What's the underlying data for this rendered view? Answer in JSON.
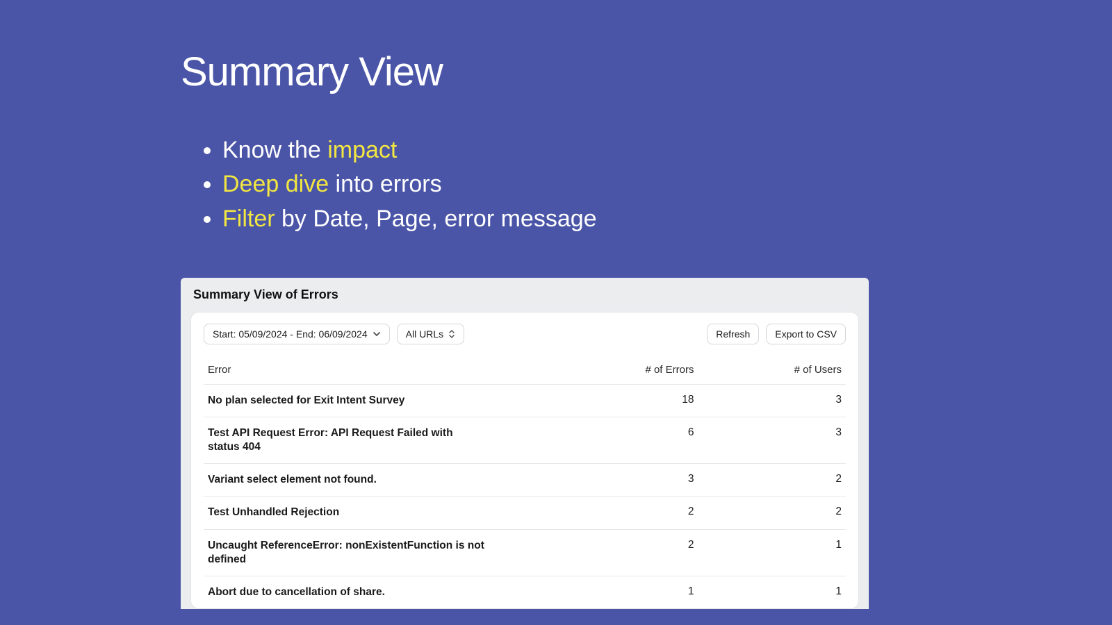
{
  "slide": {
    "title": "Summary View",
    "bullets": [
      {
        "pre": "Know the ",
        "hl": "impact",
        "post": ""
      },
      {
        "pre": "",
        "hl": "Deep dive",
        "post": " into errors"
      },
      {
        "pre": "",
        "hl": "Filter",
        "post": " by Date, Page, error message"
      }
    ]
  },
  "panel": {
    "title": "Summary View of Errors",
    "toolbar": {
      "date_range_label": "Start: 05/09/2024 - End: 06/09/2024",
      "url_filter_label": "All URLs",
      "refresh_label": "Refresh",
      "export_label": "Export to CSV"
    },
    "table": {
      "columns": {
        "error": "Error",
        "count": "# of Errors",
        "users": "# of Users"
      },
      "rows": [
        {
          "error": "No plan selected for Exit Intent Survey",
          "count": "18",
          "users": "3"
        },
        {
          "error": "Test API Request Error: API Request Failed with status 404",
          "count": "6",
          "users": "3"
        },
        {
          "error": "Variant select element not found.",
          "count": "3",
          "users": "2"
        },
        {
          "error": "Test Unhandled Rejection",
          "count": "2",
          "users": "2"
        },
        {
          "error": "Uncaught ReferenceError: nonExistentFunction is not defined",
          "count": "2",
          "users": "1"
        },
        {
          "error": "Abort due to cancellation of share.",
          "count": "1",
          "users": "1"
        }
      ]
    }
  }
}
